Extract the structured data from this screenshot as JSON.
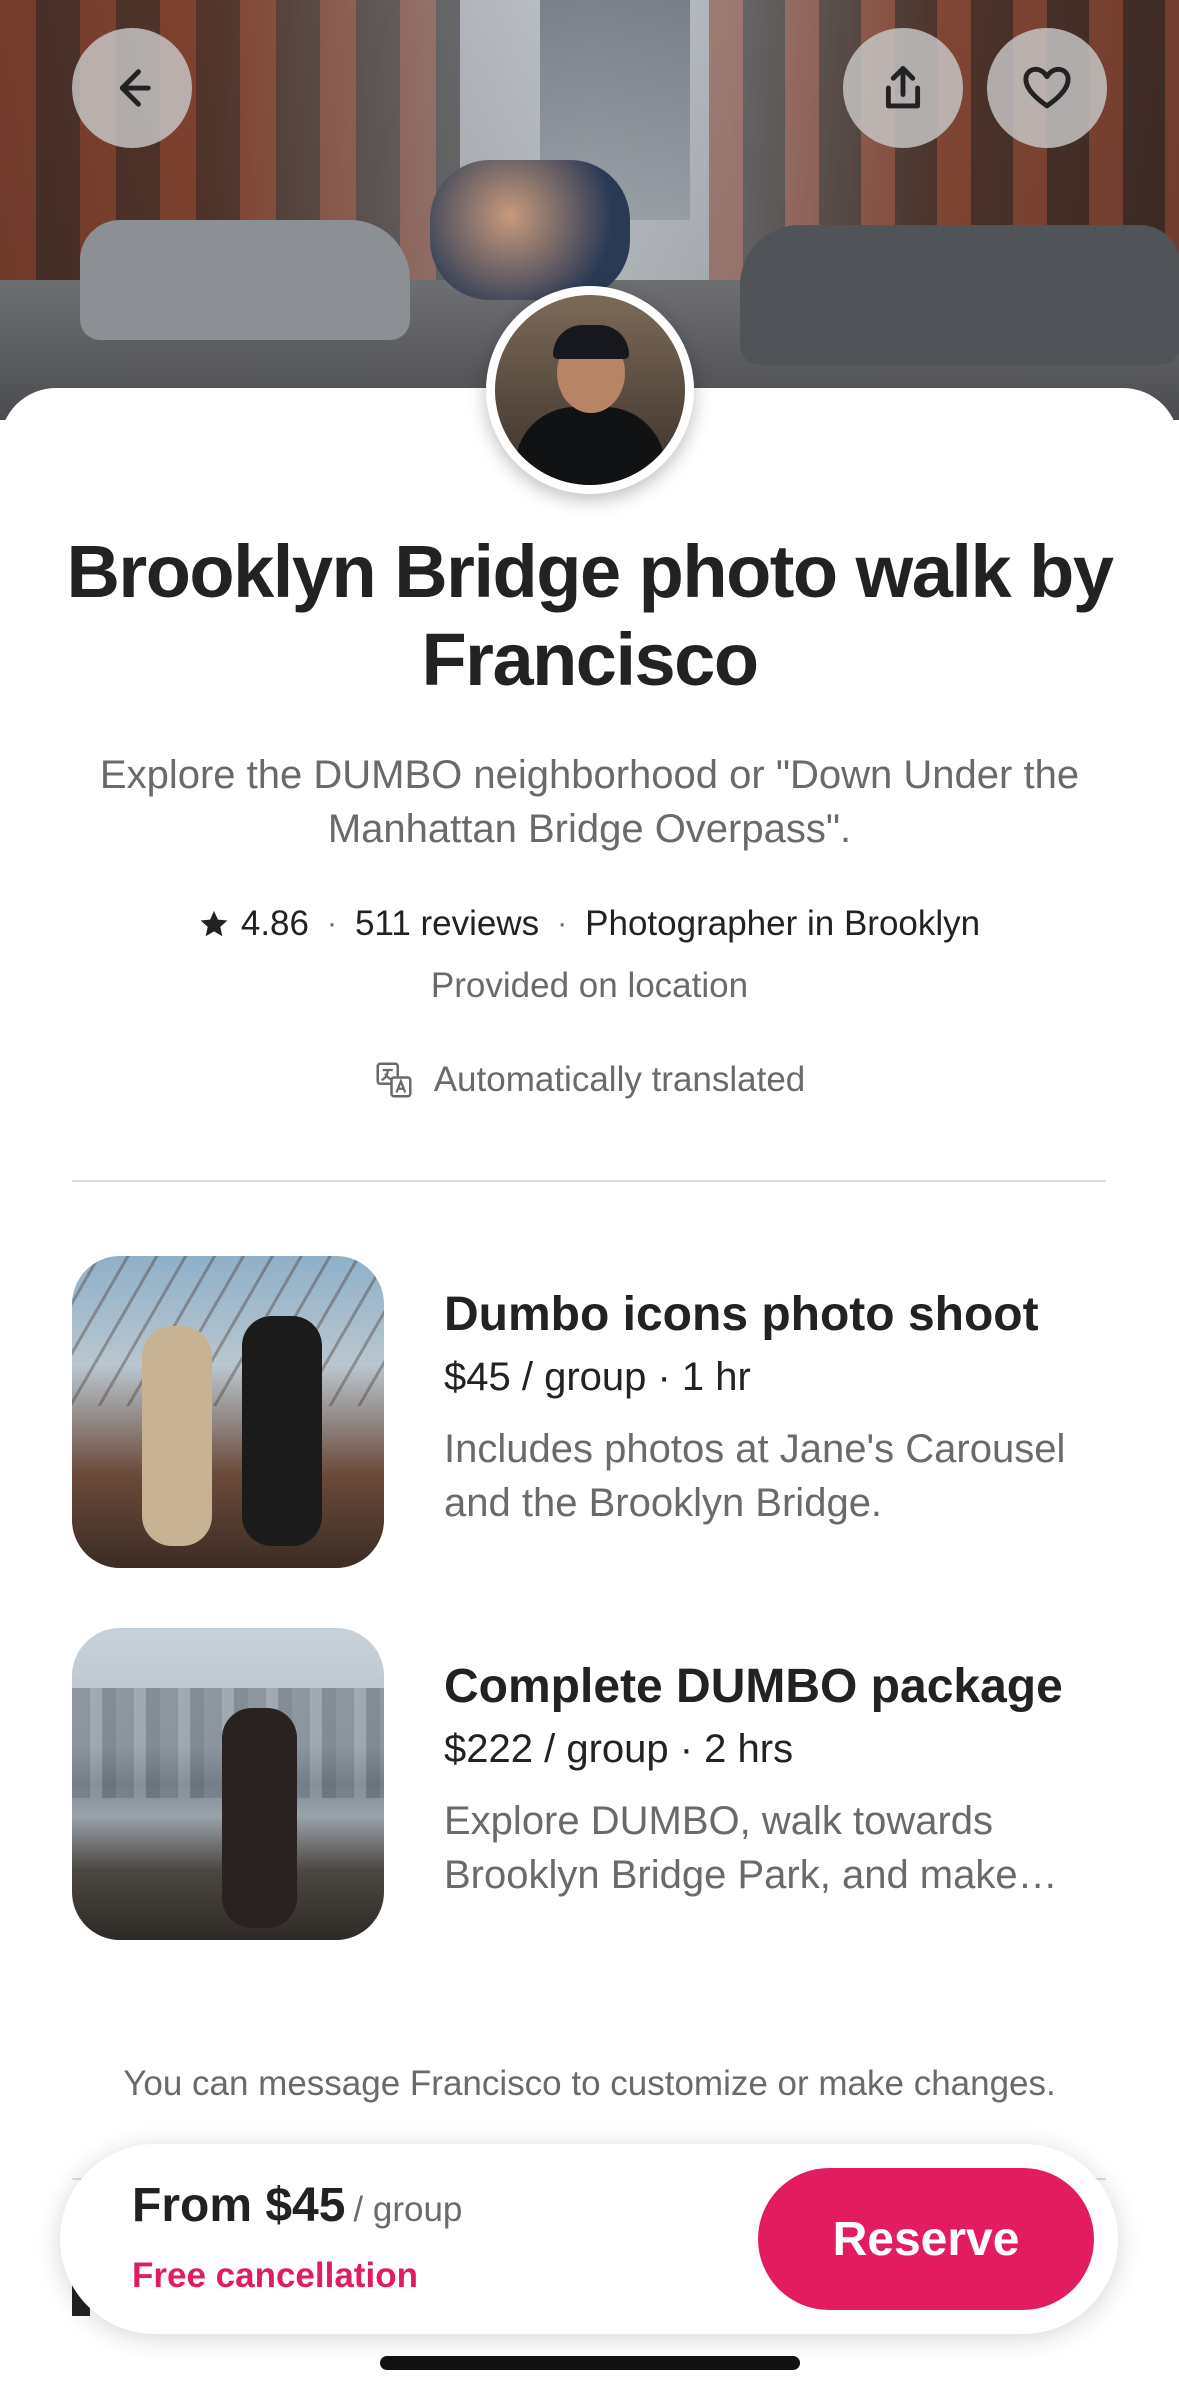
{
  "header": {
    "back_icon": "arrow-left-icon",
    "share_icon": "share-icon",
    "save_icon": "heart-icon"
  },
  "listing": {
    "title": "Brooklyn Bridge photo walk by Francisco",
    "subtitle": "Explore the DUMBO neighborhood or \"Down Under the Manhattan Bridge Overpass\".",
    "rating": "4.86",
    "reviews": "511 reviews",
    "category": "Photographer in Brooklyn",
    "location_note": "Provided on location",
    "translation_note": "Automatically translated"
  },
  "offerings": [
    {
      "name": "Dumbo icons photo shoot",
      "price": "$45 / group · 1 hr",
      "description": "Includes photos at Jane's Carousel and the Brooklyn Bridge."
    },
    {
      "name": "Complete DUMBO package",
      "price": "$222 / group · 2 hrs",
      "description": "Explore DUMBO, walk towards Brooklyn Bridge Park, and make…"
    }
  ],
  "message_note": "You can message Francisco to customize or make changes.",
  "footer": {
    "price_label": "From $45",
    "price_unit": "/ group",
    "cancellation": "Free cancellation",
    "reserve_label": "Reserve"
  },
  "colors": {
    "accent": "#e31c5f",
    "text": "#222222",
    "muted": "#6a6a6a"
  }
}
